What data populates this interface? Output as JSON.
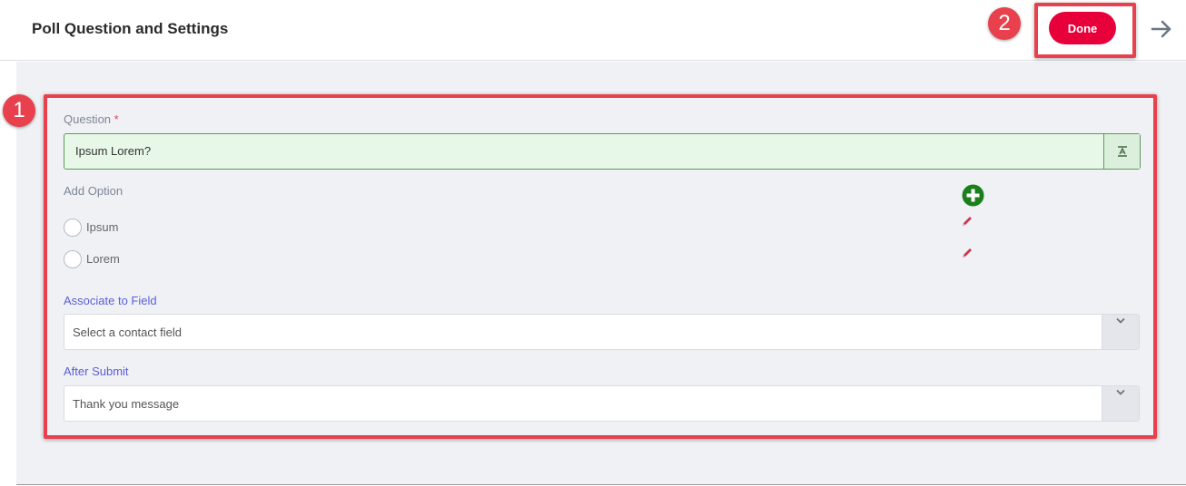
{
  "header": {
    "title": "Poll Question and Settings",
    "done_label": "Done"
  },
  "annotations": {
    "badge_1": "1",
    "badge_2": "2"
  },
  "form": {
    "question": {
      "label": "Question",
      "required_mark": "*",
      "value": "Ipsum Lorem?"
    },
    "add_option_label": "Add Option",
    "options": [
      {
        "label": "Ipsum"
      },
      {
        "label": "Lorem"
      }
    ],
    "associate_field": {
      "label": "Associate to Field",
      "value": "Select a contact field"
    },
    "after_submit": {
      "label": "After Submit",
      "value": "Thank you message"
    }
  },
  "colors": {
    "accent": "#e8003b",
    "highlight": "#e8414d",
    "link_blue": "#5a5fd6",
    "add_green": "#1b7f1b"
  },
  "icons": [
    "arrow-right-icon",
    "text-format-icon",
    "plus-circle-icon",
    "pencil-icon",
    "chevron-down-icon"
  ]
}
